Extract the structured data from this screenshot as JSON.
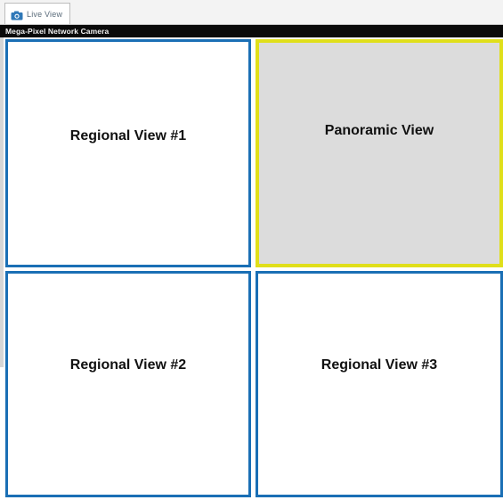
{
  "tab": {
    "label": "Live View",
    "icon": "camera-icon"
  },
  "window": {
    "title": "Mega-Pixel Network Camera"
  },
  "views": [
    {
      "label": "Regional View #1",
      "border_color": "#1a6fb5"
    },
    {
      "label": "Panoramic View",
      "border_color": "#e0df1a"
    },
    {
      "label": "Regional View #2",
      "border_color": "#1a6fb5"
    },
    {
      "label": "Regional View #3",
      "border_color": "#1a6fb5"
    }
  ]
}
